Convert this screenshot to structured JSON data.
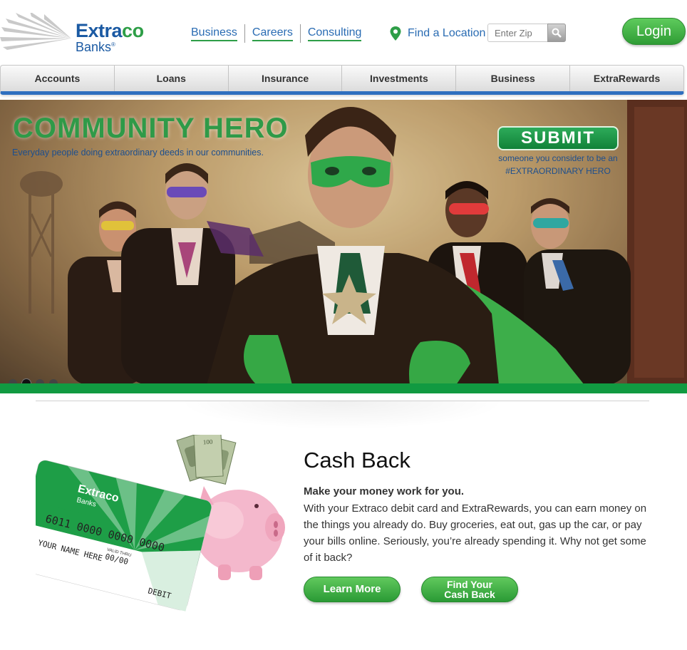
{
  "header": {
    "logo": {
      "word_main": "Extra",
      "word_accent": "co",
      "sub": "Banks",
      "mark": "®"
    },
    "links": [
      "Business",
      "Careers",
      "Consulting"
    ],
    "find_location": {
      "label": "Find a Location",
      "zip_placeholder": "Enter Zip",
      "icon": "map-pin-icon",
      "search_icon": "search-icon"
    },
    "login_label": "Login"
  },
  "nav": {
    "items": [
      "Accounts",
      "Loans",
      "Insurance",
      "Investments",
      "Business",
      "ExtraRewards"
    ]
  },
  "hero": {
    "title": "COMMUNITY HERO",
    "subtitle": "Everyday people doing extraordinary deeds in our communities.",
    "submit_label": "SUBMIT",
    "submit_note_line1": "someone you consider to be an",
    "submit_note_line2": "#EXTRAORDINARY HERO",
    "slide_count": 4,
    "active_slide": 2
  },
  "promo": {
    "card": {
      "brand": "Extraco",
      "brand_sub": "Banks",
      "number": "6011 0000 0000 0000",
      "valid_thru": "VALID THRU",
      "expiry": "00/00",
      "name": "YOUR NAME HERE",
      "type": "DEBIT"
    },
    "title": "Cash Back",
    "lead": "Make your money work for you.",
    "body": "With your Extraco debit card and ExtraRewards, you can earn money on the things you already do. Buy groceries, eat out, gas up the car, or pay your bills online. Seriously, you’re already spending it. Why not get some of it back?",
    "learn_more_label": "Learn More",
    "find_label_line1": "Find Your",
    "find_label_line2": "Cash Back"
  },
  "colors": {
    "brand_blue": "#1b5aa3",
    "brand_green": "#2e9e47",
    "nav_underline": "#2f6fbf",
    "hero_bar": "#119a41"
  }
}
